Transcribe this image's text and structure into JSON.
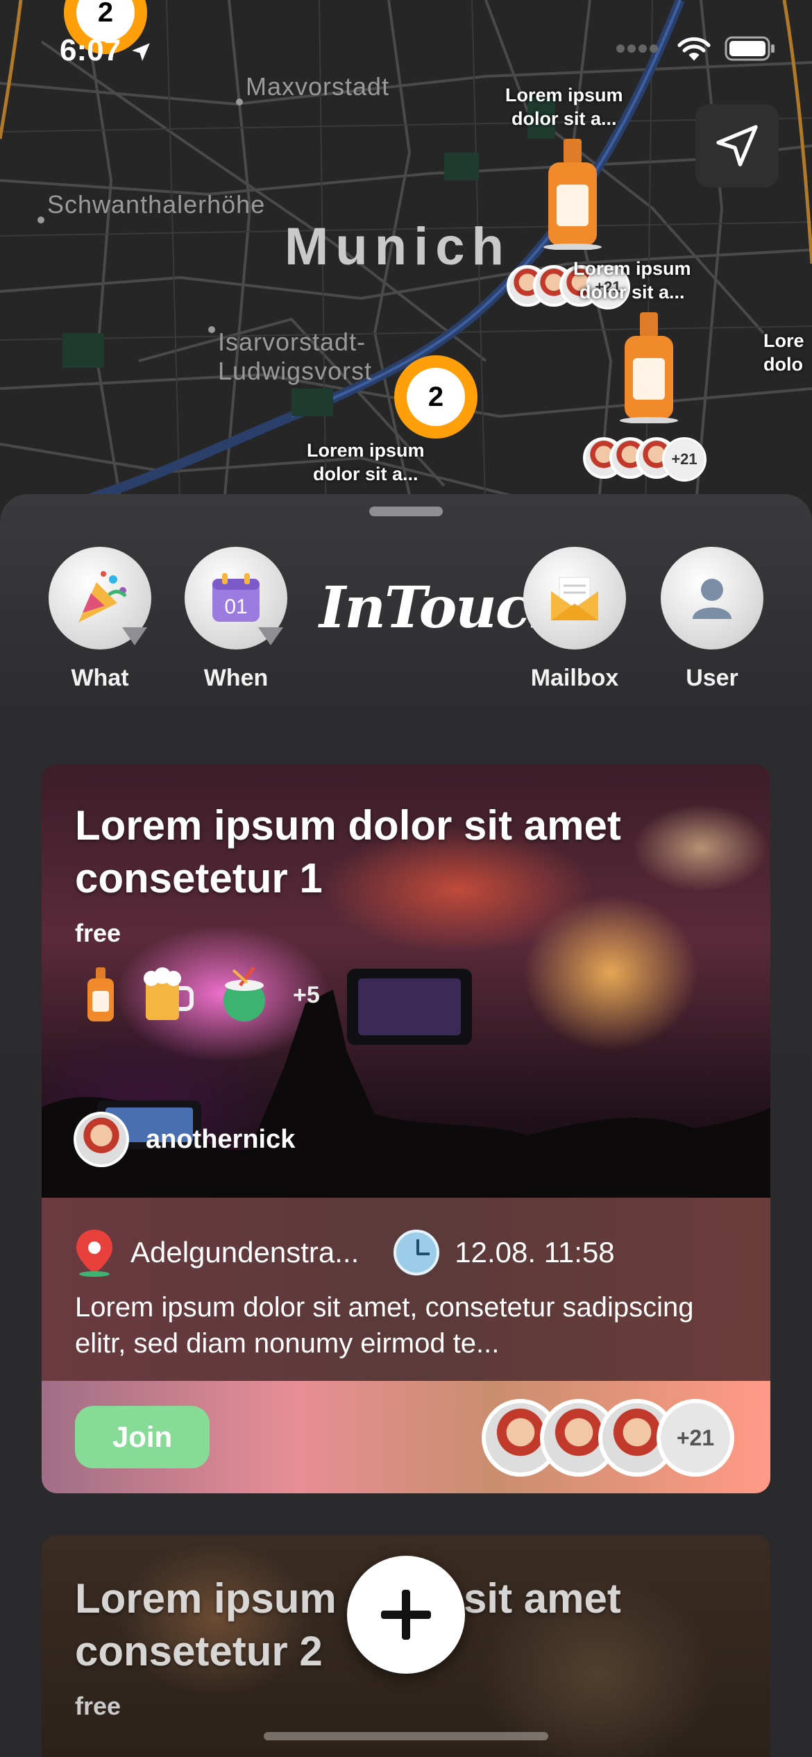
{
  "status_bar": {
    "time": "6:07"
  },
  "map": {
    "districts": [
      "Maxvorstadt",
      "Schwanthalerhöhe",
      "Isarvorstadt-",
      "Ludwigsvorst"
    ],
    "city": "Munich",
    "pins": [
      {
        "label_line1": "Lorem ipsum",
        "label_line2": "dolor sit a...",
        "extra": "+21"
      },
      {
        "label_line1": "Lorem ipsum",
        "label_line2": "dolor sit a...",
        "extra": "+21"
      },
      {
        "label_line1": "Lorem ipsum",
        "label_line2": "dolor sit a..."
      },
      {
        "label_line1": "Lore",
        "label_line2": "dolo"
      }
    ],
    "clusters": [
      "2",
      "2"
    ]
  },
  "nav": {
    "what": "What",
    "when": "When",
    "calendar_day": "01",
    "logo": "InTouch",
    "mailbox": "Mailbox",
    "user": "User"
  },
  "cards": [
    {
      "title": "Lorem ipsum dolor sit amet consetetur 1",
      "price": "free",
      "drinks": [
        "whiskey-bottle",
        "beer-mug",
        "coconut-drink"
      ],
      "drinks_more": "+5",
      "host": "anothernick",
      "address": "Adelgundenstra...",
      "datetime": "12.08. 11:58",
      "description": "Lorem ipsum dolor sit amet, consetetur sadipscing elitr, sed diam nonumy eirmod te...",
      "join": "Join",
      "participants_more": "+21"
    },
    {
      "title": "Lorem ipsum dolor sit amet consetetur 2",
      "price": "free"
    }
  ],
  "colors": {
    "accent_orange": "#ff9f0a",
    "join_green": "#86dc97",
    "sheet_bg": "#2c2c2e"
  }
}
